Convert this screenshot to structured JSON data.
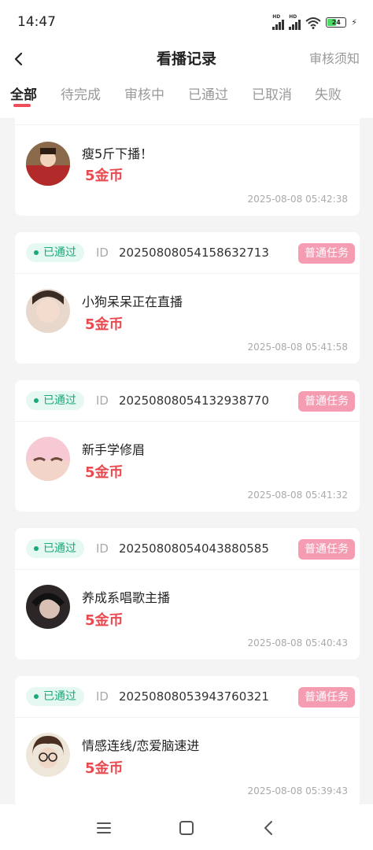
{
  "status_bar": {
    "time": "14:47",
    "signal_label": "HD",
    "battery": "24"
  },
  "header": {
    "title": "看播记录",
    "notice": "审核须知"
  },
  "tabs": [
    "全部",
    "待完成",
    "审核中",
    "已通过",
    "已取消",
    "失败"
  ],
  "active_tab": "全部",
  "id_label": "ID",
  "records": [
    {
      "status": "",
      "id": "",
      "type": "",
      "name": "瘦5斤下播！",
      "reward": "5金币",
      "time": "2025-08-08 05:42:38"
    },
    {
      "status": "已通过",
      "id": "20250808054158632713",
      "type": "普通任务",
      "name": "小狗呆呆正在直播",
      "reward": "5金币",
      "time": "2025-08-08 05:41:58"
    },
    {
      "status": "已通过",
      "id": "20250808054132938770",
      "type": "普通任务",
      "name": "新手学修眉",
      "reward": "5金币",
      "time": "2025-08-08 05:41:32"
    },
    {
      "status": "已通过",
      "id": "20250808054043880585",
      "type": "普通任务",
      "name": "养成系唱歌主播",
      "reward": "5金币",
      "time": "2025-08-08 05:40:43"
    },
    {
      "status": "已通过",
      "id": "20250808053943760321",
      "type": "普通任务",
      "name": "情感连线/恋爱脑速进",
      "reward": "5金币",
      "time": "2025-08-08 05:39:43"
    }
  ],
  "colors": {
    "accent": "#ee4d5a",
    "coin": "#e84a50",
    "status_green": "#1aa97b",
    "tag_pink": "#f59bb2"
  }
}
